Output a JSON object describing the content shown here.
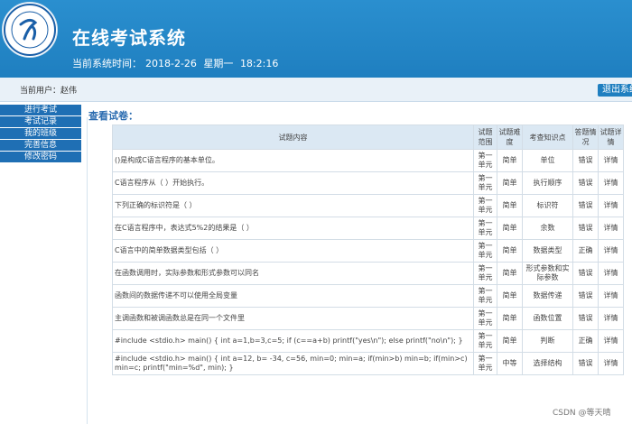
{
  "header": {
    "title": "在线考试系统",
    "time_label": "当前系统时间：",
    "date": "2018-2-26",
    "weekday": "星期一",
    "clock": "18:2:16"
  },
  "user_bar": {
    "current_user": "当前用户：赵伟",
    "logout": "退出系统"
  },
  "sidebar": {
    "items": [
      "进行考试",
      "考试记录",
      "我的班级",
      "完善信息",
      "修改密码"
    ]
  },
  "main": {
    "section_title": "查看试卷：",
    "columns": [
      "试题内容",
      "试题范围",
      "试题难度",
      "考查知识点",
      "答题情况",
      "试题详情"
    ],
    "rows": [
      {
        "content": "()是构成C语言程序的基本单位。",
        "scope": "第一单元",
        "difficulty": "简单",
        "knowledge": "单位",
        "result": "错误",
        "detail": "详情"
      },
      {
        "content": "C语言程序从（ ）开始执行。",
        "scope": "第一单元",
        "difficulty": "简单",
        "knowledge": "执行顺序",
        "result": "错误",
        "detail": "详情"
      },
      {
        "content": "下列正确的标识符是（ ）",
        "scope": "第一单元",
        "difficulty": "简单",
        "knowledge": "标识符",
        "result": "错误",
        "detail": "详情"
      },
      {
        "content": "在C语言程序中，表达式5%2的结果是（ ）",
        "scope": "第一单元",
        "difficulty": "简单",
        "knowledge": "余数",
        "result": "错误",
        "detail": "详情"
      },
      {
        "content": "C语言中的简单数据类型包括（ ）",
        "scope": "第一单元",
        "difficulty": "简单",
        "knowledge": "数据类型",
        "result": "正确",
        "detail": "详情"
      },
      {
        "content": "在函数调用时，实际参数和形式参数可以同名",
        "scope": "第一单元",
        "difficulty": "简单",
        "knowledge": "形式参数和实际参数",
        "result": "错误",
        "detail": "详情"
      },
      {
        "content": "函数间的数据传递不可以使用全局变量",
        "scope": "第一单元",
        "difficulty": "简单",
        "knowledge": "数据传递",
        "result": "错误",
        "detail": "详情"
      },
      {
        "content": "主调函数和被调函数总是在同一个文件里",
        "scope": "第一单元",
        "difficulty": "简单",
        "knowledge": "函数位置",
        "result": "错误",
        "detail": "详情"
      },
      {
        "content": "#include <stdio.h> main() { int a=1,b=3,c=5; if (c==a+b) printf(\"yes\\n\"); else printf(\"no\\n\"); }",
        "scope": "第一单元",
        "difficulty": "简单",
        "knowledge": "判断",
        "result": "正确",
        "detail": "详情"
      },
      {
        "content": "#include <stdio.h> main() { int a=12, b= -34, c=56, min=0; min=a; if(min>b) min=b; if(min>c) min=c; printf(\"min=%d\", min); }",
        "scope": "第一单元",
        "difficulty": "中等",
        "knowledge": "选择结构",
        "result": "错误",
        "detail": "详情"
      }
    ]
  },
  "watermark": "CSDN @等天晴"
}
